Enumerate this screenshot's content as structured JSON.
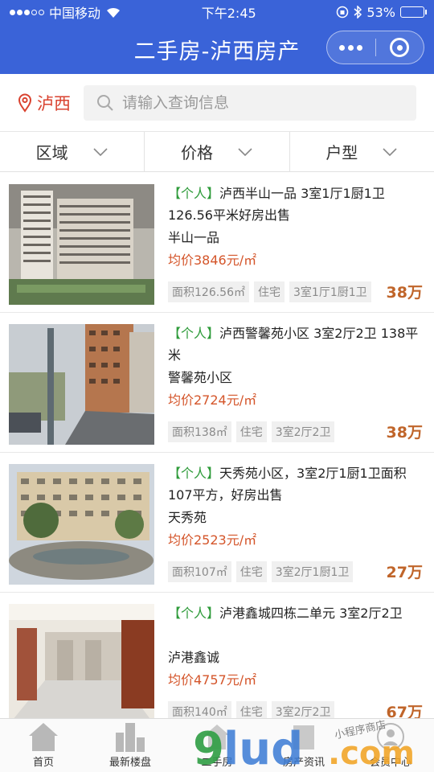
{
  "status_bar": {
    "carrier": "中国移动",
    "time": "下午2:45",
    "battery": "53%",
    "battery_level": 0.53
  },
  "header": {
    "title": "二手房-泸西房产"
  },
  "search": {
    "location": "泸西",
    "placeholder": "请输入查询信息"
  },
  "filters": [
    {
      "label": "区域"
    },
    {
      "label": "价格"
    },
    {
      "label": "户型"
    }
  ],
  "listings": [
    {
      "tag": "【个人】",
      "title": "泸西半山一品 3室1厅1厨1卫 126.56平米好房出售",
      "community": "半山一品",
      "avg_price": "均价3846元/㎡",
      "chips": [
        "面积126.56㎡",
        "住宅",
        "3室1厅1厨1卫"
      ],
      "price": "38万"
    },
    {
      "tag": "【个人】",
      "title": "泸西警馨苑小区 3室2厅2卫 138平米",
      "community": "警馨苑小区",
      "avg_price": "均价2724元/㎡",
      "chips": [
        "面积138㎡",
        "住宅",
        "3室2厅2卫"
      ],
      "price": "38万"
    },
    {
      "tag": "【个人】",
      "title": "天秀苑小区，3室2厅1厨1卫面积107平方，好房出售",
      "community": "天秀苑",
      "avg_price": "均价2523元/㎡",
      "chips": [
        "面积107㎡",
        "住宅",
        "3室2厅1厨1卫"
      ],
      "price": "27万"
    },
    {
      "tag": "【个人】",
      "title": "泸港鑫城四栋二单元 3室2厅2卫",
      "community": "泸港鑫诚",
      "avg_price": "均价4757元/㎡",
      "chips": [
        "面积140㎡",
        "住宅",
        "3室2厅2卫"
      ],
      "price": "67万"
    }
  ],
  "tabbar": [
    {
      "label": "首页",
      "icon": "home-icon"
    },
    {
      "label": "最新楼盘",
      "icon": "buildings-icon"
    },
    {
      "label": "二手房",
      "icon": "house-icon"
    },
    {
      "label": "房产资讯",
      "icon": "news-icon"
    },
    {
      "label": "会员中心",
      "icon": "user-icon"
    }
  ],
  "watermark": {
    "brand": "9lud.com",
    "script": "小程序商店"
  },
  "colors": {
    "header_bg": "#3a63d8",
    "location_red": "#d9422f",
    "tag_green": "#2e9b3a",
    "avg_orange": "#d4552a",
    "price_orange": "#c0652a"
  }
}
